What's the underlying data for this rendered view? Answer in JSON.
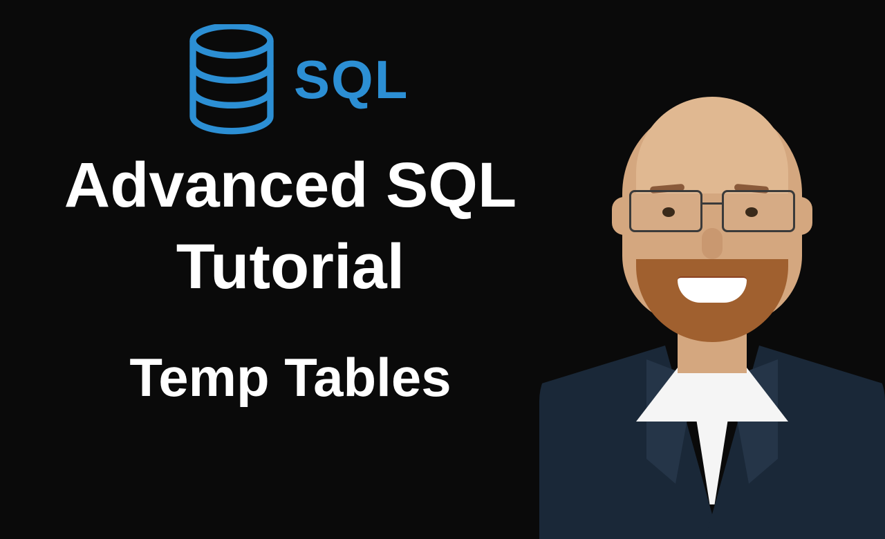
{
  "logo": {
    "label": "SQL",
    "icon_name": "database-icon",
    "color": "#2c8fd4"
  },
  "title": {
    "line1": "Advanced SQL",
    "line2": "Tutorial"
  },
  "subtitle": "Temp Tables"
}
